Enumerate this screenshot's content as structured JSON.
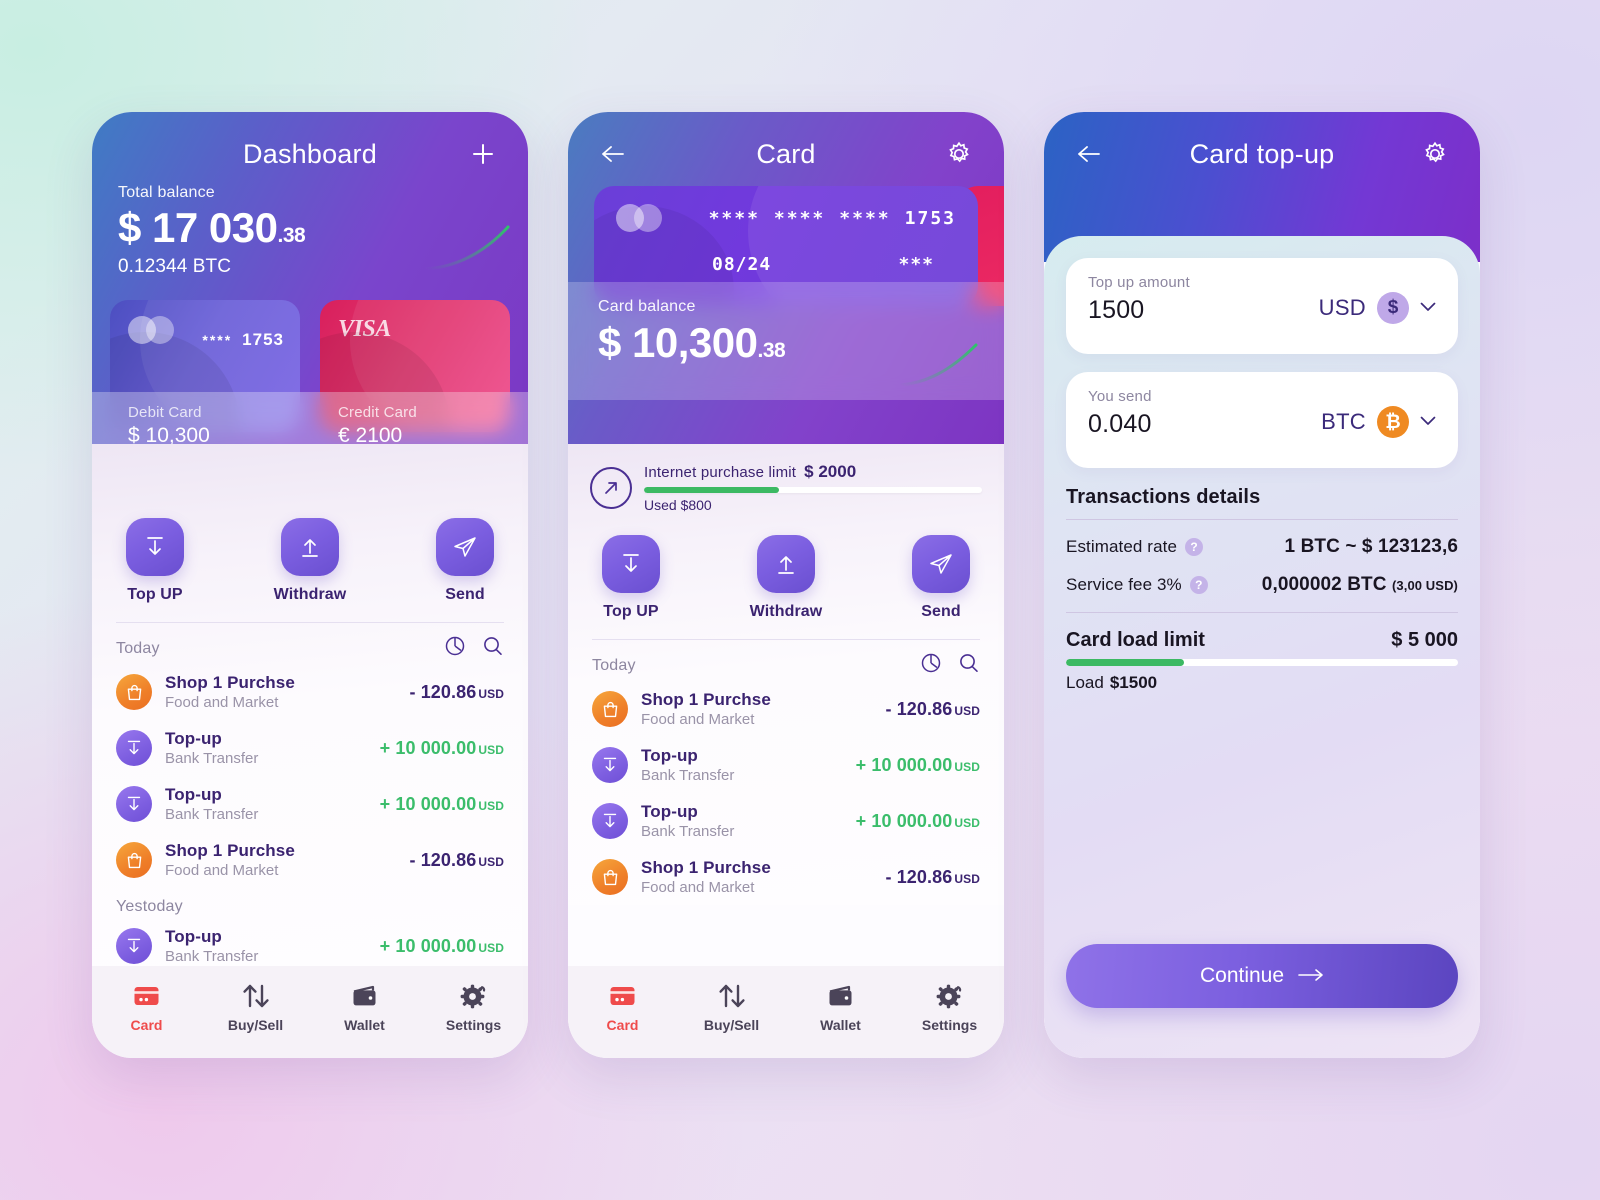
{
  "phone1": {
    "header": {
      "title": "Dashboard",
      "add_icon": "plus-icon"
    },
    "balance": {
      "label": "Total balance",
      "amount": "$ 17 030",
      "cents": ".38",
      "crypto": "0.12344 BTC"
    },
    "cards": [
      {
        "brand": "mastercard",
        "stars": "****",
        "number": "1753",
        "type": "Debit Card",
        "value": "$ 10,300"
      },
      {
        "brand": "VISA",
        "type": "Credit Card",
        "value": "€ 2100"
      }
    ],
    "actions": [
      {
        "label": "Top UP",
        "icon": "download-arrow-icon"
      },
      {
        "label": "Withdraw",
        "icon": "upload-arrow-icon"
      },
      {
        "label": "Send",
        "icon": "paper-plane-icon"
      }
    ],
    "list": {
      "today_label": "Today",
      "yesterday_label": "Yestoday",
      "chart_icon": "pie-chart-icon",
      "search_icon": "search-icon"
    },
    "transactions_today": [
      {
        "icon": "shopping-bag-icon",
        "title": "Shop 1 Purchse",
        "subtitle": "Food and Market",
        "amount": "- 120.86",
        "currency": "USD",
        "sign": "neg"
      },
      {
        "icon": "download-arrow-icon",
        "title": "Top-up",
        "subtitle": "Bank Transfer",
        "amount": "+ 10 000.00",
        "currency": "USD",
        "sign": "pos"
      },
      {
        "icon": "download-arrow-icon",
        "title": "Top-up",
        "subtitle": "Bank Transfer",
        "amount": "+ 10 000.00",
        "currency": "USD",
        "sign": "pos"
      },
      {
        "icon": "shopping-bag-icon",
        "title": "Shop 1 Purchse",
        "subtitle": "Food and Market",
        "amount": "- 120.86",
        "currency": "USD",
        "sign": "neg"
      }
    ],
    "transactions_yesterday": [
      {
        "icon": "download-arrow-icon",
        "title": "Top-up",
        "subtitle": "Bank Transfer",
        "amount": "+ 10 000.00",
        "currency": "USD",
        "sign": "pos"
      }
    ],
    "tabs": [
      {
        "label": "Card",
        "icon": "credit-card-icon",
        "active": true
      },
      {
        "label": "Buy/Sell",
        "icon": "up-down-arrows-icon",
        "active": false
      },
      {
        "label": "Wallet",
        "icon": "wallet-icon",
        "active": false
      },
      {
        "label": "Settings",
        "icon": "gear-icon",
        "active": false
      }
    ]
  },
  "phone2": {
    "header": {
      "title": "Card",
      "back_icon": "back-arrow-icon",
      "settings_icon": "gear-icon"
    },
    "card": {
      "stars1": "****",
      "stars2": "****",
      "stars3": "****",
      "number": "1753",
      "expiry": "08/24",
      "cvv": "***"
    },
    "balance": {
      "label": "Card balance",
      "amount": "$ 10,300",
      "cents": ".38"
    },
    "limit": {
      "icon": "arrow-up-right-circle-icon",
      "label": "Internet  purchase limit",
      "value": "$ 2000",
      "used": "Used $800",
      "percent": 40
    },
    "actions": [
      {
        "label": "Top UP",
        "icon": "download-arrow-icon"
      },
      {
        "label": "Withdraw",
        "icon": "upload-arrow-icon"
      },
      {
        "label": "Send",
        "icon": "paper-plane-icon"
      }
    ],
    "list": {
      "today_label": "Today",
      "chart_icon": "pie-chart-icon",
      "search_icon": "search-icon"
    },
    "transactions_today": [
      {
        "icon": "shopping-bag-icon",
        "title": "Shop 1 Purchse",
        "subtitle": "Food and Market",
        "amount": "- 120.86",
        "currency": "USD",
        "sign": "neg"
      },
      {
        "icon": "download-arrow-icon",
        "title": "Top-up",
        "subtitle": "Bank Transfer",
        "amount": "+ 10 000.00",
        "currency": "USD",
        "sign": "pos"
      },
      {
        "icon": "download-arrow-icon",
        "title": "Top-up",
        "subtitle": "Bank Transfer",
        "amount": "+ 10 000.00",
        "currency": "USD",
        "sign": "pos"
      },
      {
        "icon": "shopping-bag-icon",
        "title": "Shop 1 Purchse",
        "subtitle": "Food and Market",
        "amount": "- 120.86",
        "currency": "USD",
        "sign": "neg"
      }
    ],
    "tabs": [
      {
        "label": "Card",
        "icon": "credit-card-icon",
        "active": true
      },
      {
        "label": "Buy/Sell",
        "icon": "up-down-arrows-icon",
        "active": false
      },
      {
        "label": "Wallet",
        "icon": "wallet-icon",
        "active": false
      },
      {
        "label": "Settings",
        "icon": "gear-icon",
        "active": false
      }
    ]
  },
  "phone3": {
    "header": {
      "title": "Card top-up",
      "back_icon": "back-arrow-icon",
      "settings_icon": "gear-icon"
    },
    "field_amount": {
      "label": "Top up amount",
      "value": "1500",
      "currency": "USD",
      "badge": "$",
      "chevron": "chevron-down-icon"
    },
    "field_send": {
      "label": "You send",
      "value": "0.040",
      "currency": "BTC",
      "badge": "₿",
      "chevron": "chevron-down-icon"
    },
    "details": {
      "title": "Transactions details",
      "rows": [
        {
          "label": "Estimated rate",
          "help": "?",
          "value": "1 BTC ~ $ 123123,6",
          "suffix": ""
        },
        {
          "label": "Service fee 3%",
          "help": "?",
          "value": "0,000002 BTC",
          "suffix": "(3,00 USD)"
        }
      ]
    },
    "load_limit": {
      "label": "Card load limit",
      "value": "$ 5 000",
      "percent": 30,
      "sub_label": "Load",
      "sub_value": "$1500"
    },
    "continue_button": {
      "label": "Continue",
      "icon": "right-arrow-icon"
    }
  },
  "colors": {
    "accent_purple": "#7b5fdf",
    "accent_green": "#3cb963",
    "accent_red": "#ef4b4b",
    "card_pink": "#e31e5e",
    "bitcoin_orange": "#ef8a22",
    "text_dark": "#3b2370"
  }
}
